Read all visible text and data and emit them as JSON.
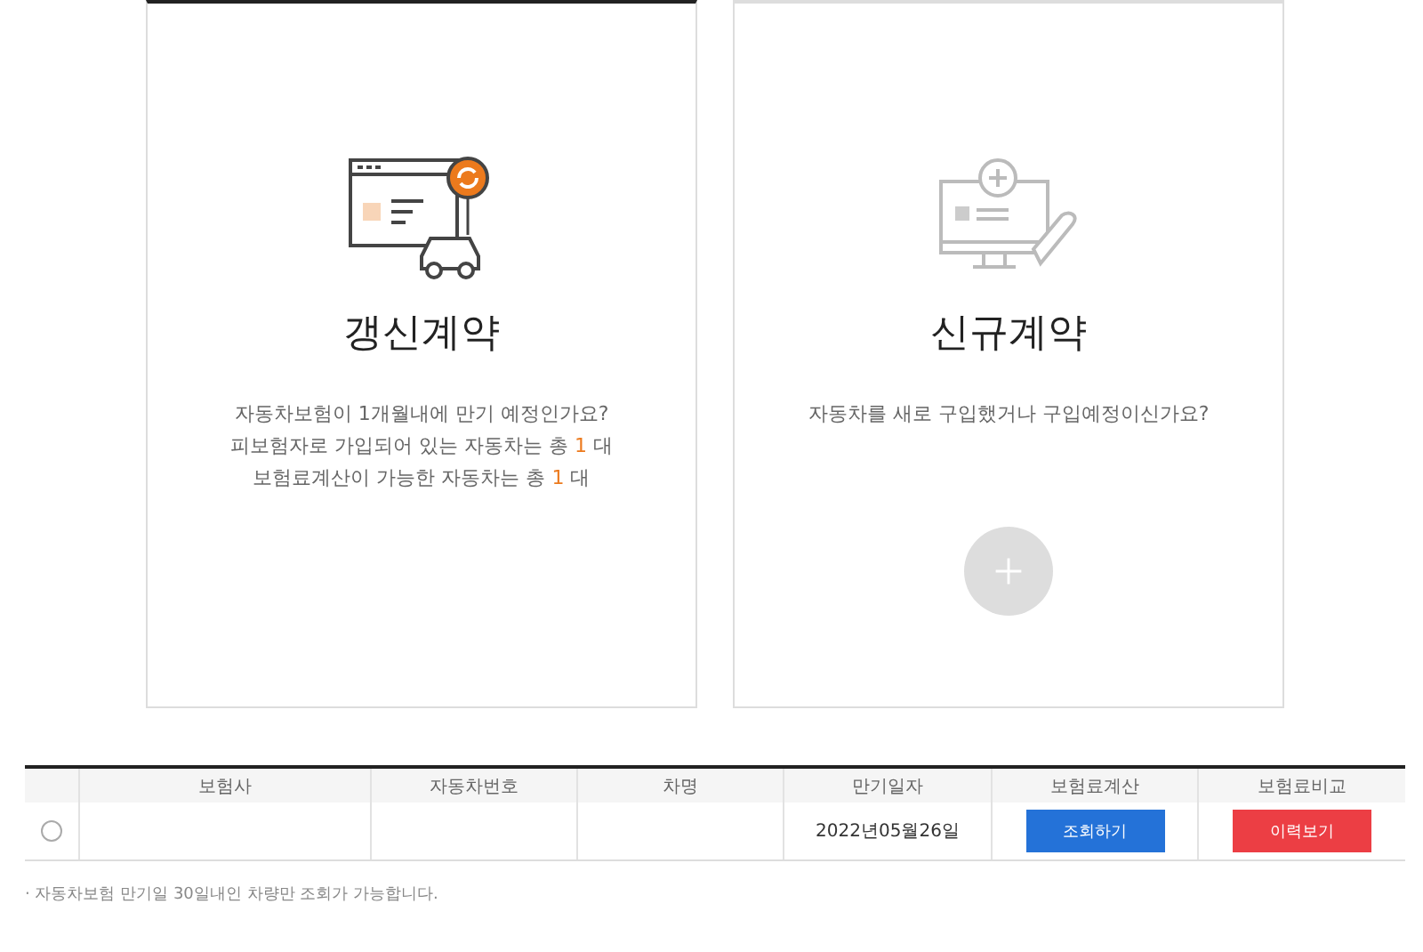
{
  "cards": [
    {
      "kind": "renewal",
      "selected": true,
      "title": "갱신계약",
      "lines": [
        {
          "text": "자동차보험이 1개월내에 만기 예정인가요?"
        },
        {
          "text": "피보험자로 가입되어 있는 자동차는 총 ",
          "count": "1",
          "unit": " 대"
        },
        {
          "text": "보험료계산이 가능한 자동차는 총 ",
          "count": "1",
          "unit": " 대"
        }
      ]
    },
    {
      "kind": "new",
      "selected": false,
      "title": "신규계약",
      "lines": [
        {
          "text": "자동차를 새로 구입했거나 구입예정이신가요?"
        }
      ],
      "add_button": true
    }
  ],
  "table": {
    "columns": [
      "보험사",
      "자동차번호",
      "차명",
      "만기일자",
      "보험료계산",
      "보험료비교"
    ],
    "rows": [
      {
        "selected": false,
        "insurer": "",
        "car_number": "",
        "car_name": "",
        "expiry": "2022년05월26일",
        "calc_button": "조회하기",
        "compare_button": "이력보기"
      }
    ]
  },
  "note": "· 자동차보험 만기일 30일내인 차량만 조회가 가능합니다."
}
